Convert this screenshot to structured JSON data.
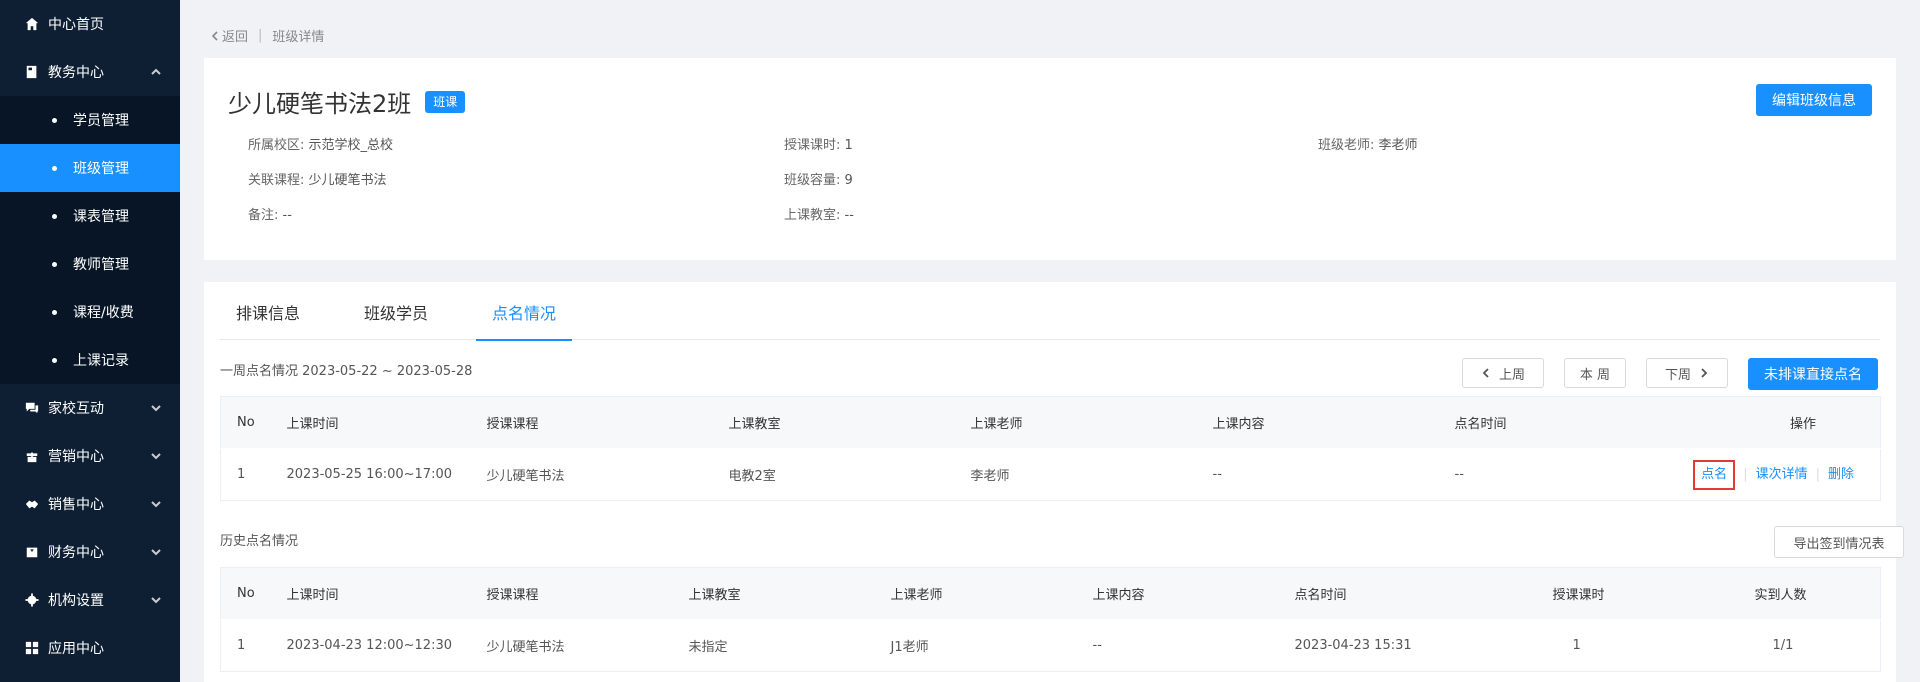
{
  "sidebar": {
    "home": "中心首页",
    "academic": "教务中心",
    "academic_items": [
      "学员管理",
      "班级管理",
      "课表管理",
      "教师管理",
      "课程/收费",
      "上课记录"
    ],
    "home_school": "家校互动",
    "marketing": "营销中心",
    "sales": "销售中心",
    "finance": "财务中心",
    "org_settings": "机构设置",
    "apps": "应用中心"
  },
  "breadcrumb": {
    "back": "返回",
    "separator": "|",
    "current": "班级详情"
  },
  "class": {
    "title": "少儿硬笔书法2班",
    "tag": "班课",
    "edit_button": "编辑班级信息",
    "campus": {
      "label": "所属校区:",
      "value": "示范学校_总校"
    },
    "hours": {
      "label": "授课课时:",
      "value": "1"
    },
    "teacher": {
      "label": "班级老师:",
      "value": "李老师"
    },
    "course": {
      "label": "关联课程:",
      "value": "少儿硬笔书法"
    },
    "capacity": {
      "label": "班级容量:",
      "value": "9"
    },
    "remark": {
      "label": "备注:",
      "value": "--"
    },
    "classroom": {
      "label": "上课教室:",
      "value": "--"
    }
  },
  "tabs": [
    "排课信息",
    "班级学员",
    "点名情况"
  ],
  "active_tab": "点名情况",
  "week": {
    "label": "一周点名情况 2023-05-22 ~ 2023-05-28",
    "prev": "上周",
    "this": "本 周",
    "next": "下周",
    "direct_rollcall": "未排课直接点名"
  },
  "week_table": {
    "headers": [
      "No",
      "上课时间",
      "授课课程",
      "上课教室",
      "上课老师",
      "上课内容",
      "点名时间",
      "操作"
    ],
    "rows": [
      {
        "no": "1",
        "time": "2023-05-25 16:00~17:00",
        "course": "少儿硬笔书法",
        "room": "电教2室",
        "teacher": "李老师",
        "content": "--",
        "rollcall_time": "--",
        "op_rollcall": "点名",
        "op_detail": "课次详情",
        "op_delete": "删除"
      }
    ]
  },
  "history": {
    "label": "历史点名情况",
    "export": "导出签到情况表",
    "headers": [
      "No",
      "上课时间",
      "授课课程",
      "上课教室",
      "上课老师",
      "上课内容",
      "点名时间",
      "授课课时",
      "实到人数"
    ],
    "rows": [
      {
        "no": "1",
        "time": "2023-04-23 12:00~12:30",
        "course": "少儿硬笔书法",
        "room": "未指定",
        "teacher": "J1老师",
        "content": "--",
        "rollcall_time": "2023-04-23 15:31",
        "hours": "1",
        "attendance": "1/1"
      }
    ]
  },
  "colors": {
    "sidebar_bg": "#0f1f33",
    "accent": "#1890ff",
    "highlight_border": "#e53935"
  }
}
